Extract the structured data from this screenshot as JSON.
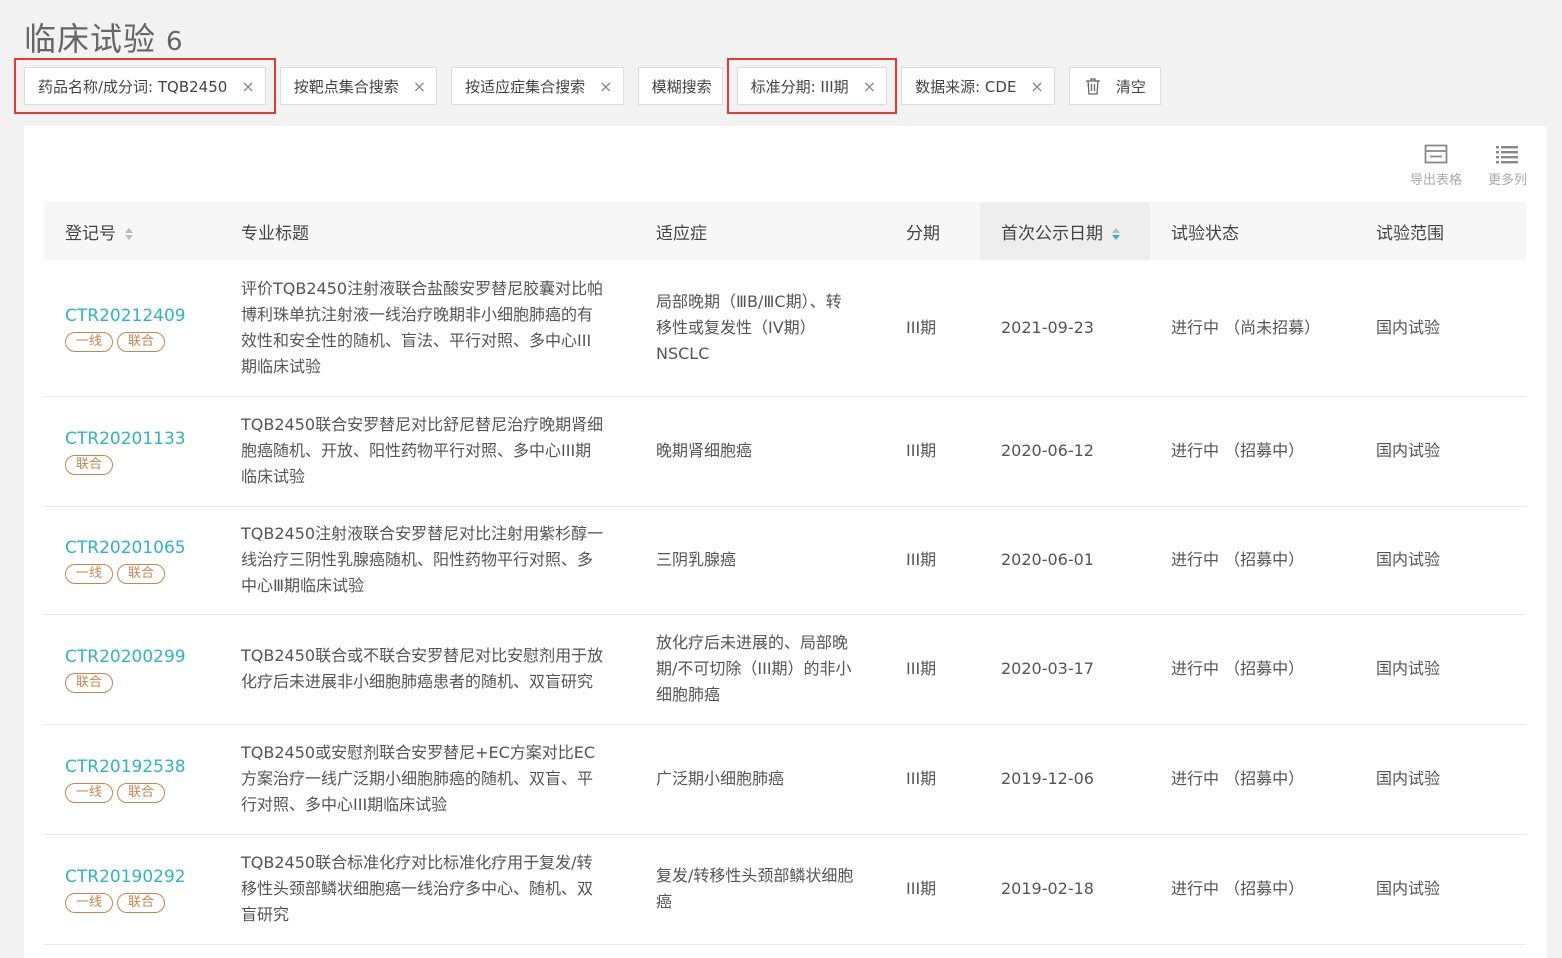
{
  "header": {
    "title": "临床试验",
    "count": "6"
  },
  "filters": [
    {
      "label": "药品名称/成分词: TQB2450",
      "highlighted": true
    },
    {
      "label": "按靶点集合搜索",
      "highlighted": false
    },
    {
      "label": "按适应症集合搜索",
      "highlighted": false
    },
    {
      "label": "模糊搜索",
      "highlighted": false,
      "no_close": true
    },
    {
      "label": "标准分期: III期",
      "highlighted": true
    },
    {
      "label": "数据来源: CDE",
      "highlighted": false
    }
  ],
  "clear_label": "清空",
  "close_glyph": "×",
  "tools": {
    "export_label": "导出表格",
    "more_cols_label": "更多列"
  },
  "table": {
    "headers": [
      "登记号",
      "专业标题",
      "适应症",
      "分期",
      "首次公示日期",
      "试验状态",
      "试验范围"
    ],
    "rows": [
      {
        "id": "CTR20212409",
        "tags": [
          "一线",
          "联合"
        ],
        "title": "评价TQB2450注射液联合盐酸安罗替尼胶囊对比帕博利珠单抗注射液一线治疗晚期非小细胞肺癌的有效性和安全性的随机、盲法、平行对照、多中心III期临床试验",
        "indication": "局部晚期（ⅢB/ⅢC期）、转移性或复发性（IV期）NSCLC",
        "phase": "III期",
        "date": "2021-09-23",
        "status": "进行中 （尚未招募）",
        "scope": "国内试验"
      },
      {
        "id": "CTR20201133",
        "tags": [
          "联合"
        ],
        "title": "TQB2450联合安罗替尼对比舒尼替尼治疗晚期肾细胞癌随机、开放、阳性药物平行对照、多中心III期临床试验",
        "indication": "晚期肾细胞癌",
        "phase": "III期",
        "date": "2020-06-12",
        "status": "进行中 （招募中）",
        "scope": "国内试验"
      },
      {
        "id": "CTR20201065",
        "tags": [
          "一线",
          "联合"
        ],
        "title": "TQB2450注射液联合安罗替尼对比注射用紫杉醇一线治疗三阴性乳腺癌随机、阳性药物平行对照、多中心Ⅲ期临床试验",
        "indication": "三阴乳腺癌",
        "phase": "III期",
        "date": "2020-06-01",
        "status": "进行中 （招募中）",
        "scope": "国内试验"
      },
      {
        "id": "CTR20200299",
        "tags": [
          "联合"
        ],
        "title": "TQB2450联合或不联合安罗替尼对比安慰剂用于放化疗后未进展非小细胞肺癌患者的随机、双盲研究",
        "indication": "放化疗后未进展的、局部晚期/不可切除（III期）的非小细胞肺癌",
        "phase": "III期",
        "date": "2020-03-17",
        "status": "进行中 （招募中）",
        "scope": "国内试验"
      },
      {
        "id": "CTR20192538",
        "tags": [
          "一线",
          "联合"
        ],
        "title": "TQB2450或安慰剂联合安罗替尼+EC方案对比EC方案治疗一线广泛期小细胞肺癌的随机、双盲、平行对照、多中心III期临床试验",
        "indication": "广泛期小细胞肺癌",
        "phase": "III期",
        "date": "2019-12-06",
        "status": "进行中 （招募中）",
        "scope": "国内试验"
      },
      {
        "id": "CTR20190292",
        "tags": [
          "一线",
          "联合"
        ],
        "title": "TQB2450联合标准化疗对比标准化疗用于复发/转移性头颈部鳞状细胞癌一线治疗多中心、随机、双盲研究",
        "indication": "复发/转移性头颈部鳞状细胞癌",
        "phase": "III期",
        "date": "2019-02-18",
        "status": "进行中 （招募中）",
        "scope": "国内试验"
      }
    ]
  },
  "colors": {
    "accent": "#2bb5c9",
    "tag": "#c6864f",
    "highlight": "#e53935"
  }
}
